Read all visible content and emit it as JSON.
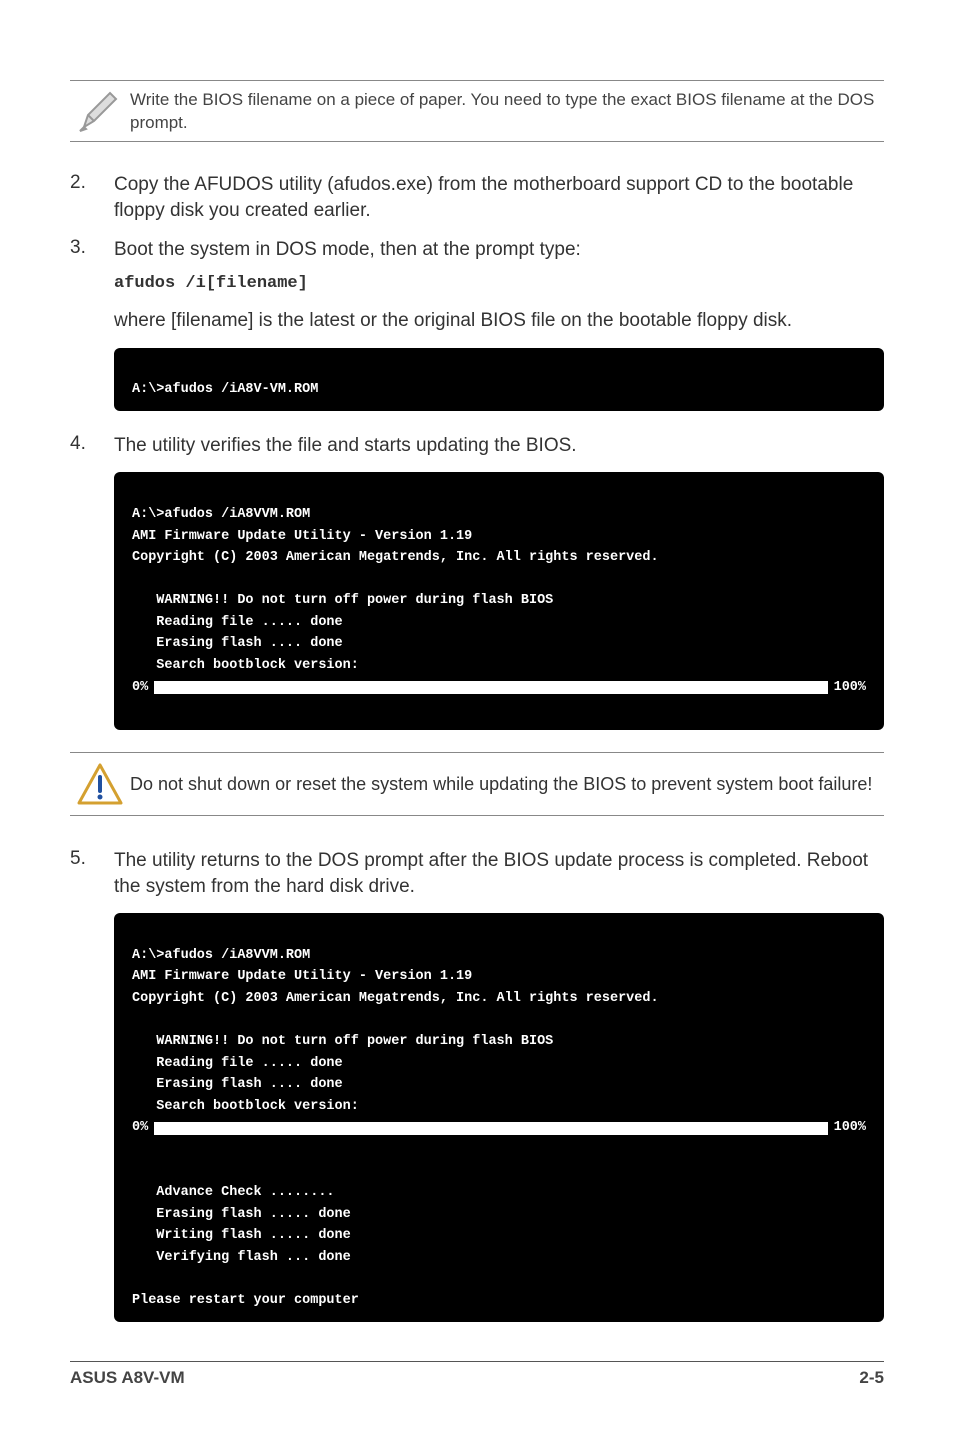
{
  "note": {
    "text": "Write the BIOS filename on a piece of paper. You need to type the exact BIOS filename at the DOS prompt."
  },
  "steps": {
    "s2_num": "2.",
    "s2_text": "Copy the AFUDOS utility (afudos.exe) from the motherboard support CD to the bootable floppy disk you created earlier.",
    "s3_num": "3.",
    "s3_text": "Boot the system in DOS mode, then at the prompt type:",
    "s3_cmd": "afudos /i[filename]",
    "s3_where": "where [filename] is the latest or the original BIOS file on the bootable floppy disk.",
    "s4_num": "4.",
    "s4_text": "The utility verifies the file and starts updating the BIOS.",
    "s5_num": "5.",
    "s5_text": "The utility returns to the DOS prompt after the BIOS update process is completed. Reboot the system from the hard disk drive."
  },
  "term1": {
    "line1": "A:\\>afudos /iA8V-VM.ROM"
  },
  "term2": {
    "l1": "A:\\>afudos /iA8VVM.ROM",
    "l2": "AMI Firmware Update Utility - Version 1.19",
    "l3": "Copyright (C) 2003 American Megatrends, Inc. All rights reserved.",
    "l4": "   WARNING!! Do not turn off power during flash BIOS",
    "l5": "   Reading file ..... done",
    "l6": "   Erasing flash .... done",
    "l7": "   Search bootblock version:",
    "p_left": "   0%",
    "p_right": "100%"
  },
  "warning": {
    "text": "Do not shut down or reset the system while updating the BIOS to prevent system boot failure!"
  },
  "term3": {
    "l1": "A:\\>afudos /iA8VVM.ROM",
    "l2": "AMI Firmware Update Utility - Version 1.19",
    "l3": "Copyright (C) 2003 American Megatrends, Inc. All rights reserved.",
    "l4": "   WARNING!! Do not turn off power during flash BIOS",
    "l5": "   Reading file ..... done",
    "l6": "   Erasing flash .... done",
    "l7": "   Search bootblock version:",
    "p_left": "   0%",
    "p_right": "100%",
    "l8": "   Advance Check ........",
    "l9": "   Erasing flash ..... done",
    "l10": "   Writing flash ..... done",
    "l11": "   Verifying flash ... done",
    "l12": "Please restart your computer"
  },
  "footer": {
    "left": "ASUS A8V-VM",
    "right": "2-5"
  }
}
